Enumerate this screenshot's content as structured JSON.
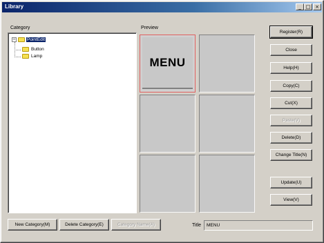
{
  "window": {
    "title": "Library",
    "minimize": "_",
    "maximize": "□",
    "close": "×"
  },
  "category": {
    "label": "Category"
  },
  "tree": {
    "root": {
      "expander": "−",
      "label": "PointEdit"
    },
    "children": [
      {
        "label": "Button"
      },
      {
        "label": "Lamp"
      }
    ]
  },
  "preview": {
    "label": "Preview",
    "selected_item_text": "MENU"
  },
  "buttons": {
    "register": "Register(R)",
    "close": "Close",
    "help": "Help(H)",
    "copy": "Copy(C)",
    "cut": "Cut(X)",
    "paste": "Paste(V)",
    "delete": "Delete(D)",
    "change_title": "Change Title(N)",
    "update": "Update(U)",
    "view": "View(V)"
  },
  "bottom": {
    "new_category": "New Category(M)",
    "delete_category": "Delete Category(E)",
    "rename_category": "Category Name(A)",
    "title_label": "Title",
    "title_value": "MENU"
  }
}
